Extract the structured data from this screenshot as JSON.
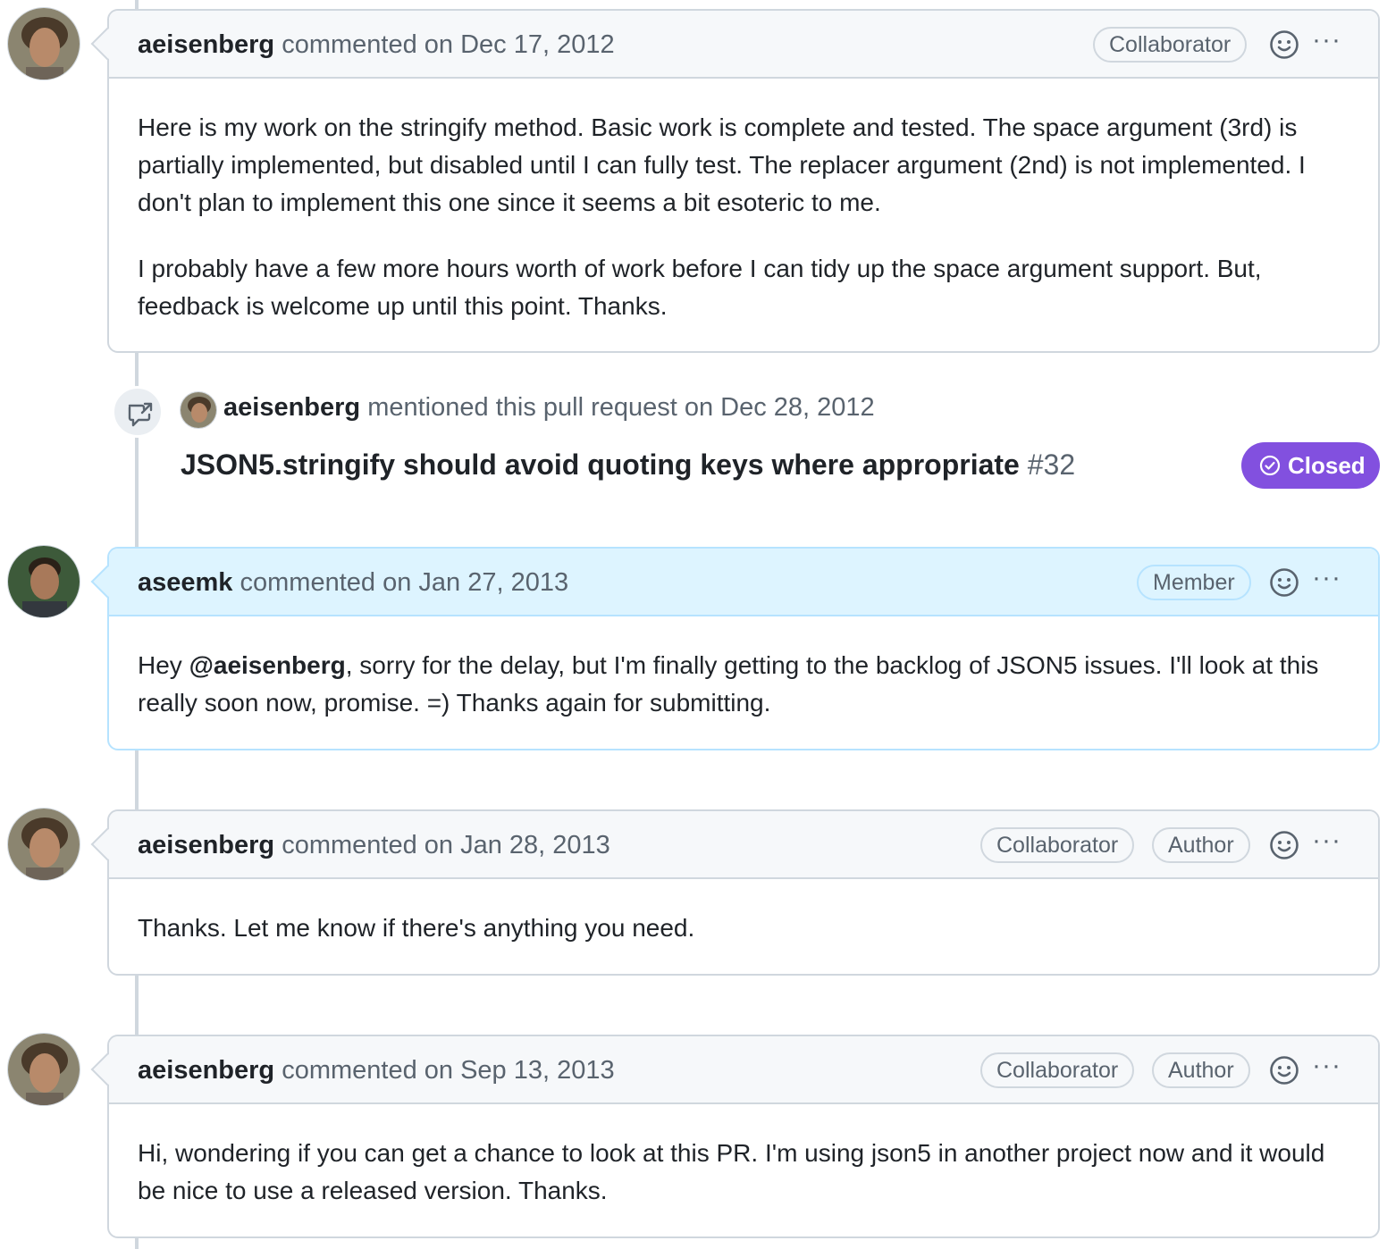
{
  "comments": [
    {
      "author": "aeisenberg",
      "action": "commented on Dec 17, 2012",
      "badges": [
        "Collaborator"
      ],
      "paragraphs": [
        "Here is my work on the stringify method. Basic work is complete and tested. The space argument (3rd) is partially implemented, but disabled until I can fully test. The replacer argument (2nd) is not implemented. I don't plan to implement this one since it seems a bit esoteric to me.",
        "I probably have a few more hours worth of work before I can tidy up the space argument support. But, feedback is welcome up until this point. Thanks."
      ]
    },
    {
      "author": "aseemk",
      "action": "commented on Jan 27, 2013",
      "badges": [
        "Member"
      ],
      "body_prefix": "Hey ",
      "body_mention": "@aeisenberg",
      "body_suffix": ", sorry for the delay, but I'm finally getting to the backlog of JSON5 issues. I'll look at this really soon now, promise. =) Thanks again for submitting."
    },
    {
      "author": "aeisenberg",
      "action": "commented on Jan 28, 2013",
      "badges": [
        "Collaborator",
        "Author"
      ],
      "paragraphs": [
        "Thanks. Let me know if there's anything you need."
      ]
    },
    {
      "author": "aeisenberg",
      "action": "commented on Sep 13, 2013",
      "badges": [
        "Collaborator",
        "Author"
      ],
      "paragraphs": [
        "Hi, wondering if you can get a chance to look at this PR. I'm using json5 in another project now and it would be nice to use a released version. Thanks."
      ]
    }
  ],
  "event": {
    "author": "aeisenberg",
    "action": "mentioned this pull request on Dec 28, 2012",
    "ref_title": "JSON5.stringify should avoid quoting keys where appropriate",
    "ref_number": "#32",
    "state": "Closed",
    "icon": "cross-reference-icon"
  },
  "more_label": "···",
  "colors": {
    "closed_badge": "#8250df",
    "highlight_header": "#ddf4ff",
    "default_header": "#f6f8fa",
    "border": "#d0d7de"
  }
}
